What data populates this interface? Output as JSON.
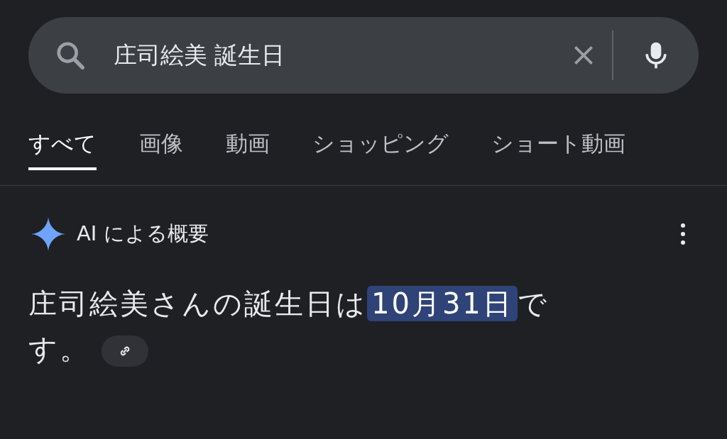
{
  "search": {
    "value": "庄司絵美 誕生日"
  },
  "tabs": [
    {
      "label": "すべて",
      "selected": true
    },
    {
      "label": "画像",
      "selected": false
    },
    {
      "label": "動画",
      "selected": false
    },
    {
      "label": "ショッピング",
      "selected": false
    },
    {
      "label": "ショート動画",
      "selected": false
    }
  ],
  "ai_overview": {
    "title": "AI による概要",
    "answer": {
      "before": "庄司絵美さんの誕生日は",
      "highlight": "10月31日",
      "after": "です。"
    }
  }
}
